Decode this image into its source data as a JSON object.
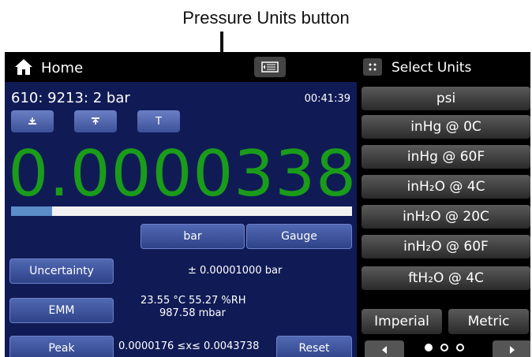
{
  "annotation": {
    "label": "Pressure Units button"
  },
  "header": {
    "home_label": "Home",
    "select_units_title": "Select Units"
  },
  "channel": {
    "label": "610: 9213:  2 bar",
    "time": "00:41:39"
  },
  "small_buttons": {
    "tare_label": "T"
  },
  "reading": {
    "value": "0.0000338",
    "bar_fraction": 0.12
  },
  "units_row": {
    "unit": "bar",
    "mode": "Gauge"
  },
  "uncertainty": {
    "button": "Uncertainty",
    "value": "± 0.00001000   bar"
  },
  "emm": {
    "button": "EMM",
    "line1": "23.55 °C   55.27 %RH",
    "line2": "987.58 mbar"
  },
  "peak": {
    "button": "Peak",
    "range": "0.0000176 ≤x≤ 0.0043738",
    "reset": "Reset"
  },
  "unit_options": [
    "psi",
    "inHg @ 0C",
    "inHg @ 60F",
    "inH₂O @ 4C",
    "inH₂O @ 20C",
    "inH₂O @ 60F",
    "ftH₂O @ 4C"
  ],
  "systems": {
    "imperial": "Imperial",
    "metric": "Metric"
  },
  "colors": {
    "panel_bg": "#101b56",
    "reading_green": "#1a9c1a",
    "bar_fill": "#5b8ec9"
  }
}
